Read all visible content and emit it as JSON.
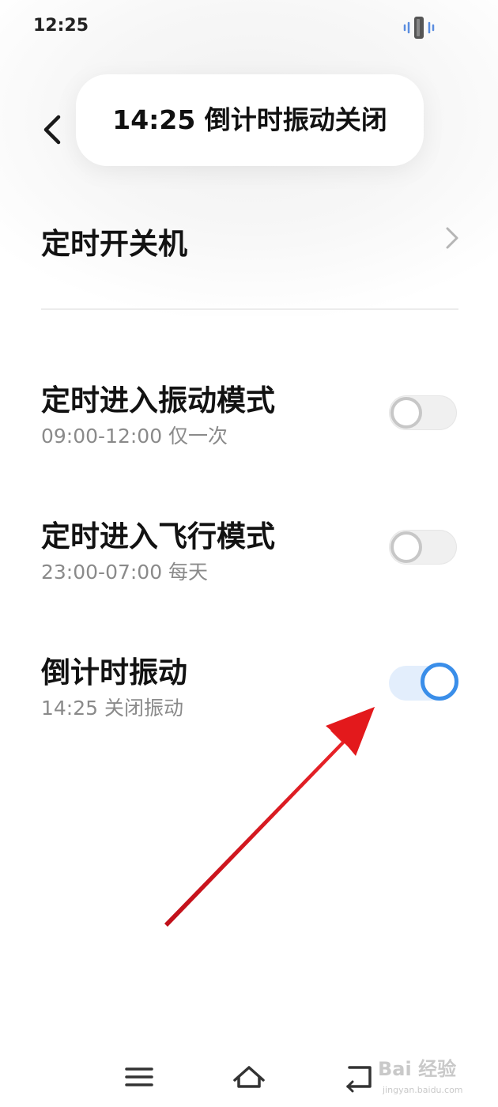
{
  "status_bar": {
    "time": "12:25",
    "vibrate_icon": "vibrate-mode-icon"
  },
  "toast": {
    "text": "14:25 倒计时振动关闭"
  },
  "back_icon": "back-chevron-icon",
  "settings": [
    {
      "title": "定时开关机",
      "control": "chevron",
      "icon": "chevron-right-icon"
    },
    {
      "title": "定时进入振动模式",
      "subtitle": "09:00-12:00 仅一次",
      "control": "toggle",
      "enabled": false
    },
    {
      "title": "定时进入飞行模式",
      "subtitle": "23:00-07:00 每天",
      "control": "toggle",
      "enabled": false
    },
    {
      "title": "倒计时振动",
      "subtitle": "14:25 关闭振动",
      "control": "toggle",
      "enabled": true
    }
  ],
  "colors": {
    "toggle_on": "#3a8ee9",
    "toggle_on_track": "#e3eefc",
    "annotation_arrow": "#e3191c"
  },
  "annotation": {
    "icon": "red-arrow-annotation"
  },
  "nav_bar": {
    "menu_icon": "menu-icon",
    "home_icon": "home-icon",
    "back_icon": "back-nav-icon"
  },
  "watermark": {
    "text": "Bai 经验",
    "sub": "jingyan.baidu.com"
  }
}
